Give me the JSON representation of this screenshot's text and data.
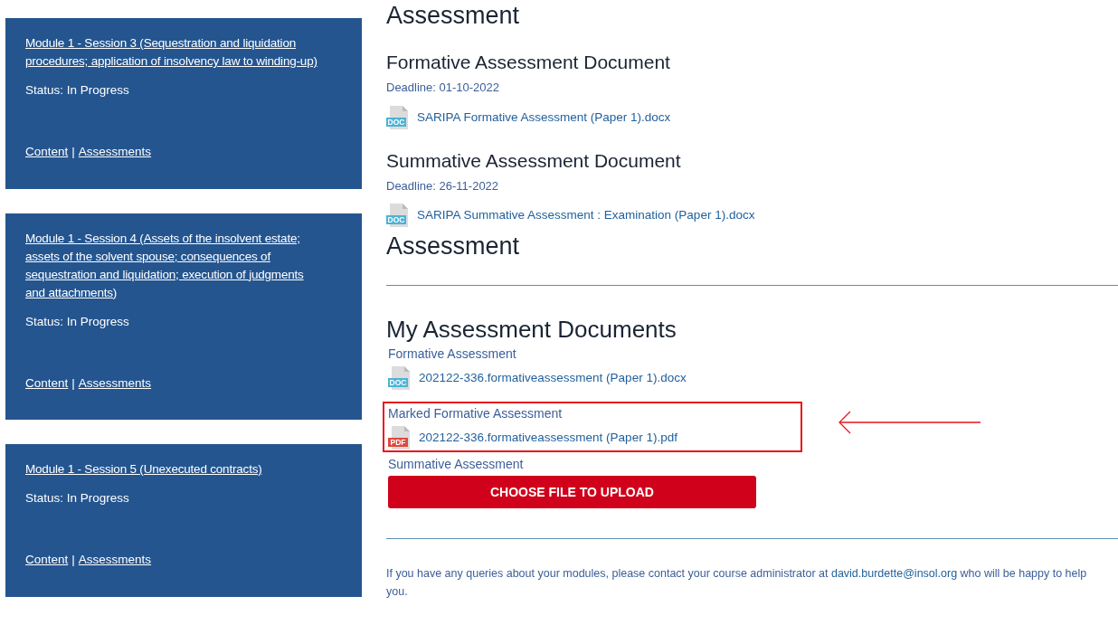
{
  "modules": [
    {
      "title": "Module 1 - Session 3 (Sequestration and liquidation procedures; application of insolvency law to winding-up)",
      "status": "Status: In Progress",
      "links": [
        "Content",
        "Assessments"
      ],
      "separator": "|"
    },
    {
      "title": "Module 1 - Session 4 (Assets of the insolvent estate; assets of the solvent spouse; consequences of sequestration and liquidation; execution of judgments and attachments)",
      "status": "Status: In Progress",
      "links": [
        "Content",
        "Assessments"
      ],
      "separator": "|"
    },
    {
      "title": "Module 1 - Session 5 (Unexecuted contracts)",
      "status": "Status: In Progress",
      "links": [
        "Content",
        "Assessments"
      ],
      "separator": "|"
    }
  ],
  "assessment": {
    "title": "Assessment",
    "sections": [
      {
        "heading": "Formative Assessment Document",
        "deadline": "Deadline: 01-10-2022",
        "file": {
          "kind": "doc",
          "icon_label": "DOC",
          "name": "SARIPA Formative Assessment (Paper 1).docx"
        }
      },
      {
        "heading": "Summative Assessment Document",
        "deadline": "Deadline: 26-11-2022",
        "file": {
          "kind": "doc",
          "icon_label": "DOC",
          "name": "SARIPA Summative Assessment : Examination (Paper 1).docx"
        }
      }
    ]
  },
  "my_documents": {
    "title": "Assessment",
    "heading": "My Assessment Documents",
    "groups": [
      {
        "label": "Formative Assessment",
        "highlighted": false,
        "file": {
          "kind": "doc",
          "icon_label": "DOC",
          "name": "202122-336.formativeassessment (Paper 1).docx"
        }
      },
      {
        "label": "Marked Formative Assessment",
        "highlighted": true,
        "file": {
          "kind": "pdf",
          "icon_label": "PDF",
          "name": "202122-336.formativeassessment (Paper 1).pdf"
        }
      },
      {
        "label": "Summative Assessment",
        "highlighted": false,
        "button": "CHOOSE FILE TO UPLOAD"
      }
    ]
  },
  "footer": {
    "before": "If you have any queries about your modules, please contact your course administrator at ",
    "email": "david.burdette@insol.org",
    "after": " who will be happy to help you."
  }
}
